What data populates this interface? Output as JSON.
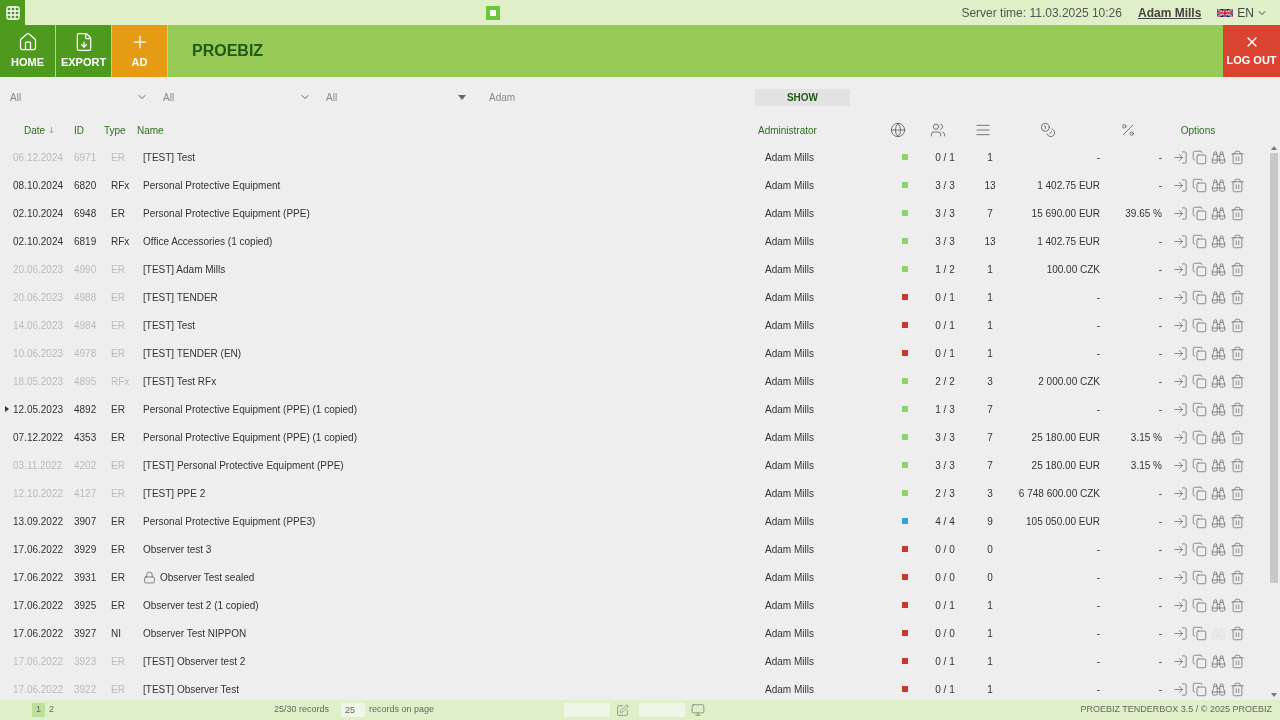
{
  "topbar": {
    "server_time": "Server time: 11.03.2025 10:26",
    "user": "Adam Mills",
    "language": "EN"
  },
  "nav": [
    {
      "label": "HOME",
      "kind": "home",
      "selected": false
    },
    {
      "label": "EXPORT",
      "kind": "export",
      "selected": false
    },
    {
      "label": "AD",
      "kind": "add",
      "selected": true
    }
  ],
  "brand": "PROEBIZ",
  "logout": "LOG OUT",
  "filters": {
    "selects": [
      {
        "value": "All"
      },
      {
        "value": "All"
      },
      {
        "value": "All"
      }
    ],
    "search_value": "Adam",
    "button": "SHOW"
  },
  "table": {
    "columns": [
      "Date",
      "ID",
      "Type",
      "Name",
      "Administrator",
      "Options"
    ],
    "rows": [
      {
        "date": "06.12.2024",
        "id": "6971",
        "type": "ER",
        "name": "[TEST] Test",
        "admin": "Adam Mills",
        "color": "#8fd16a",
        "participants": "0 / 1",
        "items": "1",
        "price": "-",
        "percent": "-",
        "muted": true,
        "sealed": false,
        "pointer": false,
        "observers_enabled": true
      },
      {
        "date": "08.10.2024",
        "id": "6820",
        "type": "RFx",
        "name": "Personal Protective Equipment",
        "admin": "Adam Mills",
        "color": "#8fd16a",
        "participants": "3 / 3",
        "items": "13",
        "price": "1 402.75 EUR",
        "percent": "-",
        "muted": false,
        "sealed": false,
        "pointer": false,
        "observers_enabled": true
      },
      {
        "date": "02.10.2024",
        "id": "6948",
        "type": "ER",
        "name": "Personal Protective Equipment (PPE)",
        "admin": "Adam Mills",
        "color": "#8fd16a",
        "participants": "3 / 3",
        "items": "7",
        "price": "15 690.00 EUR",
        "percent": "39.65 %",
        "muted": false,
        "sealed": false,
        "pointer": false,
        "observers_enabled": true
      },
      {
        "date": "02.10.2024",
        "id": "6819",
        "type": "RFx",
        "name": "Office Accessories (1 copied)",
        "admin": "Adam Mills",
        "color": "#8fd16a",
        "participants": "3 / 3",
        "items": "13",
        "price": "1 402.75 EUR",
        "percent": "-",
        "muted": false,
        "sealed": false,
        "pointer": false,
        "observers_enabled": true
      },
      {
        "date": "20.06.2023",
        "id": "4990",
        "type": "ER",
        "name": "[TEST] Adam Mills",
        "admin": "Adam Mills",
        "color": "#8fd16a",
        "participants": "1 / 2",
        "items": "1",
        "price": "100.00 CZK",
        "percent": "-",
        "muted": true,
        "sealed": false,
        "pointer": false,
        "observers_enabled": true
      },
      {
        "date": "20.06.2023",
        "id": "4988",
        "type": "ER",
        "name": "[TEST] TENDER",
        "admin": "Adam Mills",
        "color": "#c7392b",
        "participants": "0 / 1",
        "items": "1",
        "price": "-",
        "percent": "-",
        "muted": true,
        "sealed": false,
        "pointer": false,
        "observers_enabled": true
      },
      {
        "date": "14.06.2023",
        "id": "4984",
        "type": "ER",
        "name": "[TEST] Test",
        "admin": "Adam Mills",
        "color": "#c7392b",
        "participants": "0 / 1",
        "items": "1",
        "price": "-",
        "percent": "-",
        "muted": true,
        "sealed": false,
        "pointer": false,
        "observers_enabled": true
      },
      {
        "date": "10.06.2023",
        "id": "4978",
        "type": "ER",
        "name": "[TEST] TENDER (EN)",
        "admin": "Adam Mills",
        "color": "#c7392b",
        "participants": "0 / 1",
        "items": "1",
        "price": "-",
        "percent": "-",
        "muted": true,
        "sealed": false,
        "pointer": false,
        "observers_enabled": true
      },
      {
        "date": "18.05.2023",
        "id": "4895",
        "type": "RFx",
        "name": "[TEST] Test RFx",
        "admin": "Adam Mills",
        "color": "#8fd16a",
        "participants": "2 / 2",
        "items": "3",
        "price": "2 000.00 CZK",
        "percent": "-",
        "muted": true,
        "sealed": false,
        "pointer": false,
        "observers_enabled": true
      },
      {
        "date": "12.05.2023",
        "id": "4892",
        "type": "ER",
        "name": "Personal Protective Equipment (PPE) (1 copied)",
        "admin": "Adam Mills",
        "color": "#8fd16a",
        "participants": "1 / 3",
        "items": "7",
        "price": "-",
        "percent": "-",
        "muted": false,
        "sealed": false,
        "pointer": true,
        "observers_enabled": true
      },
      {
        "date": "07.12.2022",
        "id": "4353",
        "type": "ER",
        "name": "Personal Protective Equipment (PPE) (1 copied)",
        "admin": "Adam Mills",
        "color": "#8fd16a",
        "participants": "3 / 3",
        "items": "7",
        "price": "25 180.00 EUR",
        "percent": "3.15 %",
        "muted": false,
        "sealed": false,
        "pointer": false,
        "observers_enabled": true
      },
      {
        "date": "03.11.2022",
        "id": "4202",
        "type": "ER",
        "name": "[TEST] Personal Protective Equipment (PPE)",
        "admin": "Adam Mills",
        "color": "#8fd16a",
        "participants": "3 / 3",
        "items": "7",
        "price": "25 180.00 EUR",
        "percent": "3.15 %",
        "muted": true,
        "sealed": false,
        "pointer": false,
        "observers_enabled": true
      },
      {
        "date": "12.10.2022",
        "id": "4127",
        "type": "ER",
        "name": "[TEST] PPE 2",
        "admin": "Adam Mills",
        "color": "#8fd16a",
        "participants": "2 / 3",
        "items": "3",
        "price": "6 748 600.00 CZK",
        "percent": "-",
        "muted": true,
        "sealed": false,
        "pointer": false,
        "observers_enabled": true
      },
      {
        "date": "13.09.2022",
        "id": "3907",
        "type": "ER",
        "name": "Personal Protective Equipment (PPE3)",
        "admin": "Adam Mills",
        "color": "#2aa3d8",
        "participants": "4 / 4",
        "items": "9",
        "price": "105 050.00 EUR",
        "percent": "-",
        "muted": false,
        "sealed": false,
        "pointer": false,
        "observers_enabled": true
      },
      {
        "date": "17.06.2022",
        "id": "3929",
        "type": "ER",
        "name": "Observer test 3",
        "admin": "Adam Mills",
        "color": "#c7392b",
        "participants": "0 / 0",
        "items": "0",
        "price": "-",
        "percent": "-",
        "muted": false,
        "sealed": false,
        "pointer": false,
        "observers_enabled": true
      },
      {
        "date": "17.06.2022",
        "id": "3931",
        "type": "ER",
        "name": "Observer Test sealed",
        "admin": "Adam Mills",
        "color": "#c7392b",
        "participants": "0 / 0",
        "items": "0",
        "price": "-",
        "percent": "-",
        "muted": false,
        "sealed": true,
        "pointer": false,
        "observers_enabled": true
      },
      {
        "date": "17.06.2022",
        "id": "3925",
        "type": "ER",
        "name": "Observer test 2 (1 copied)",
        "admin": "Adam Mills",
        "color": "#c7392b",
        "participants": "0 / 1",
        "items": "1",
        "price": "-",
        "percent": "-",
        "muted": false,
        "sealed": false,
        "pointer": false,
        "observers_enabled": true
      },
      {
        "date": "17.06.2022",
        "id": "3927",
        "type": "NI",
        "name": "Observer Test NIPPON",
        "admin": "Adam Mills",
        "color": "#c7392b",
        "participants": "0 / 0",
        "items": "1",
        "price": "-",
        "percent": "-",
        "muted": false,
        "sealed": false,
        "pointer": false,
        "observers_enabled": false
      },
      {
        "date": "17.06.2022",
        "id": "3923",
        "type": "ER",
        "name": "[TEST] Observer test 2",
        "admin": "Adam Mills",
        "color": "#c7392b",
        "participants": "0 / 1",
        "items": "1",
        "price": "-",
        "percent": "-",
        "muted": true,
        "sealed": false,
        "pointer": false,
        "observers_enabled": true
      },
      {
        "date": "17.06.2022",
        "id": "3922",
        "type": "ER",
        "name": "[TEST] Observer Test",
        "admin": "Adam Mills",
        "color": "#c7392b",
        "participants": "0 / 1",
        "items": "1",
        "price": "-",
        "percent": "-",
        "muted": true,
        "sealed": false,
        "pointer": false,
        "observers_enabled": true
      }
    ]
  },
  "footer": {
    "pages": [
      {
        "label": "1",
        "selected": true
      },
      {
        "label": "2",
        "selected": false
      }
    ],
    "records": "25/30 records",
    "per_page": "25",
    "per_page_label": "records on page",
    "copyright": "PROEBIZ TENDERBOX 3.5 / © 2025 PROEBIZ"
  }
}
